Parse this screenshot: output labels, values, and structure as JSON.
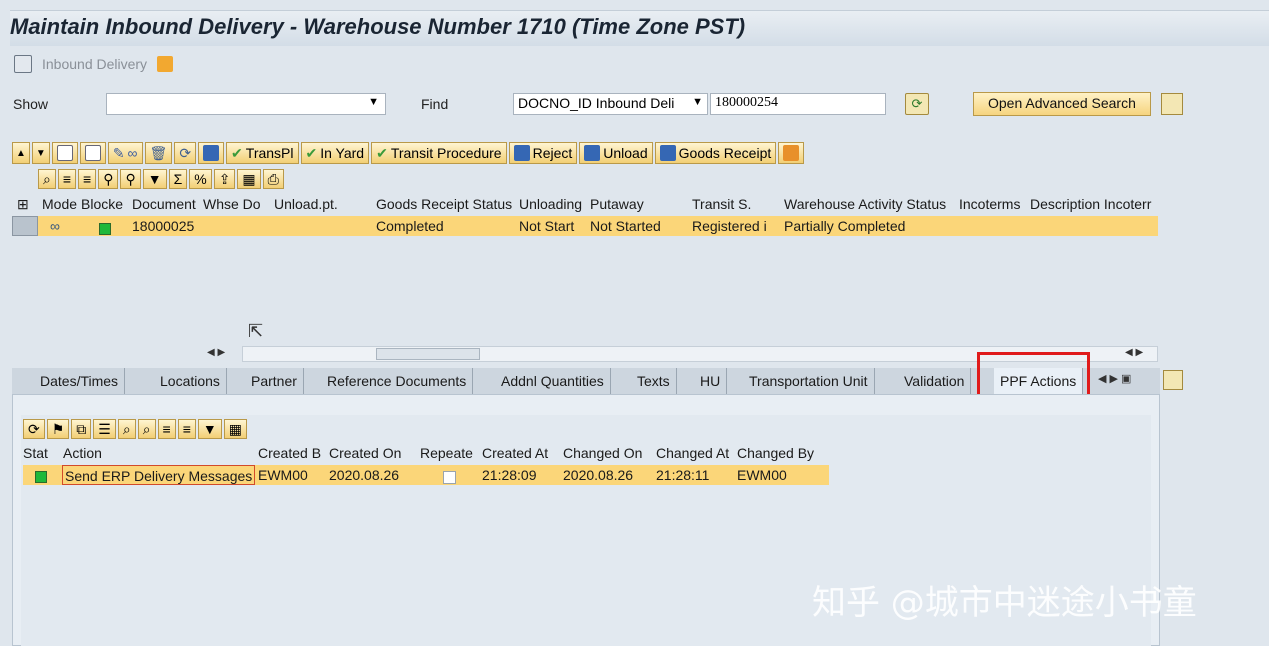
{
  "window": {
    "title": "Maintain Inbound Delivery - Warehouse Number 1710 (Time Zone PST)",
    "breadcrumb": "Inbound Delivery"
  },
  "search": {
    "show_label": "Show",
    "show_value": "",
    "find_label": "Find",
    "find_field": "DOCNO_ID Inbound Deli",
    "find_value": "180000254",
    "advanced_button": "Open Advanced Search"
  },
  "toolbar": {
    "transpl": "TransPl",
    "in_yard": "In Yard",
    "transit_procedure": "Transit Procedure",
    "reject": "Reject",
    "unload": "Unload",
    "goods_receipt": "Goods Receipt"
  },
  "main_table": {
    "columns": [
      "Mode",
      "Blocke",
      "Document",
      "Whse Do",
      "Unload.pt.",
      "Goods Receipt Status",
      "Unloading",
      "Putaway",
      "Transit S.",
      "Warehouse Activity Status",
      "Incoterms",
      "Description Incoterr"
    ],
    "row": {
      "document": "18000025",
      "goods_receipt_status": "Completed",
      "unloading": "Not Start",
      "putaway": "Not Started",
      "transit": "Registered i",
      "warehouse_activity": "Partially Completed"
    }
  },
  "tabs": [
    "Dates/Times",
    "Locations",
    "Partner",
    "Reference Documents",
    "Addnl Quantities",
    "Texts",
    "HU",
    "Transportation Unit",
    "Validation",
    "PPF Actions"
  ],
  "ppf_table": {
    "columns": [
      "Stat",
      "Action",
      "Created B",
      "Created On",
      "Repeate",
      "Created At",
      "Changed On",
      "Changed At",
      "Changed By"
    ],
    "row": {
      "action": "Send ERP Delivery Messages",
      "created_by": "EWM00",
      "created_on": "2020.08.26",
      "created_at": "21:28:09",
      "changed_on": "2020.08.26",
      "changed_at": "21:28:11",
      "changed_by": "EWM00"
    }
  },
  "watermark": "知乎 @城市中迷途小书童",
  "colors": {
    "selected_row": "#fbd679",
    "status_green": "#1fb83a",
    "highlight": "#e01b1b"
  }
}
